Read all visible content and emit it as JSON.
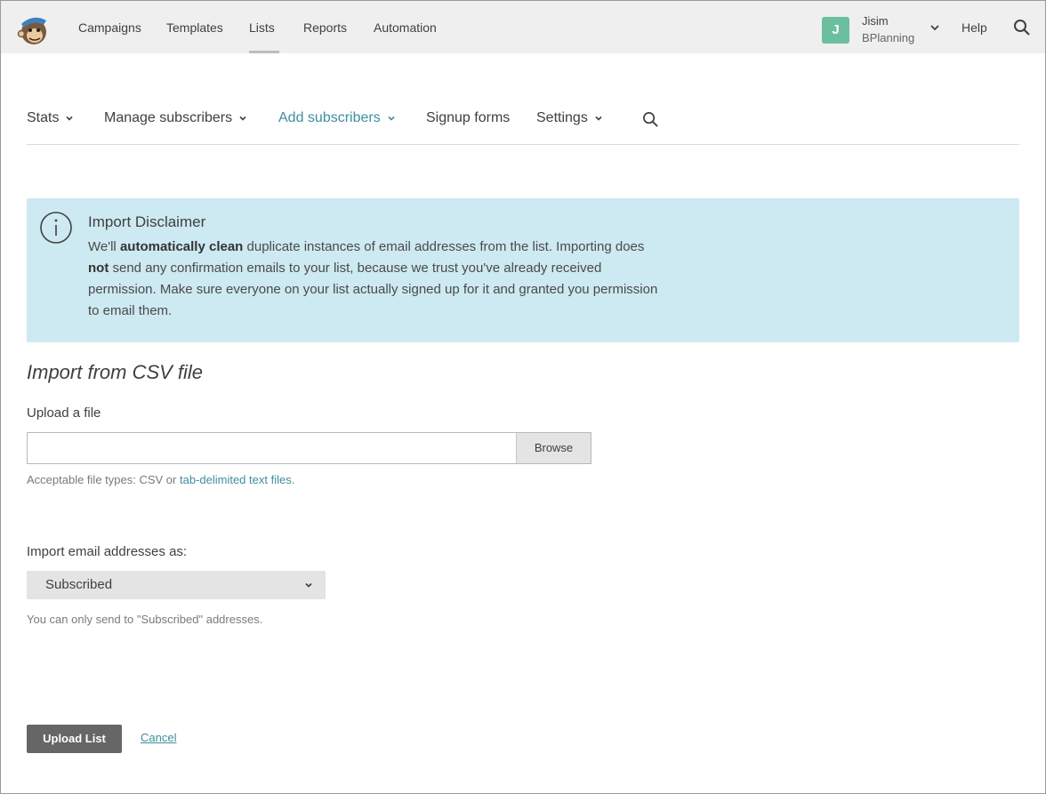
{
  "topnav": {
    "items": [
      {
        "label": "Campaigns"
      },
      {
        "label": "Templates"
      },
      {
        "label": "Lists"
      },
      {
        "label": "Reports"
      },
      {
        "label": "Automation"
      }
    ],
    "active_index": 2,
    "account": {
      "initial": "J",
      "name": "Jisim",
      "org": "BPlanning"
    },
    "help_label": "Help",
    "icons": {
      "logo": "mailchimp-logo",
      "account_menu": "chevron-down-icon",
      "search": "search-icon"
    }
  },
  "subnav": {
    "items": [
      {
        "label": "Stats",
        "has_menu": true
      },
      {
        "label": "Manage subscribers",
        "has_menu": true
      },
      {
        "label": "Add subscribers",
        "has_menu": true,
        "active": true
      },
      {
        "label": "Signup forms",
        "has_menu": false
      },
      {
        "label": "Settings",
        "has_menu": true
      }
    ]
  },
  "disclaimer": {
    "icon": "info-icon",
    "title": "Import Disclaimer",
    "body": {
      "p1": "We'll ",
      "b1": "automatically clean",
      "p2": " duplicate instances of email addresses from the list. Importing does ",
      "b2": "not",
      "p3": " send any confirmation emails to your list, because we trust you've already received permission. Make sure everyone on your list actually signed up for it and granted you permission to email them."
    }
  },
  "form": {
    "section_title": "Import from CSV file",
    "upload_label": "Upload a file",
    "file_value": "",
    "browse_label": "Browse",
    "hint_prefix": "Acceptable file types: CSV or ",
    "hint_link": "tab-delimited text files",
    "hint_suffix": ".",
    "import_as_label": "Import email addresses as:",
    "import_as_value": "Subscribed",
    "import_as_hint": "You can only send to \"Subscribed\" addresses.",
    "upload_button": "Upload List",
    "cancel_link": "Cancel"
  },
  "colors": {
    "accent": "#3e8e9f",
    "avatar": "#6bbf9e",
    "disclaimer_bg": "#cde9f1",
    "primary_button": "#666666",
    "topbar_bg": "#efefef"
  }
}
